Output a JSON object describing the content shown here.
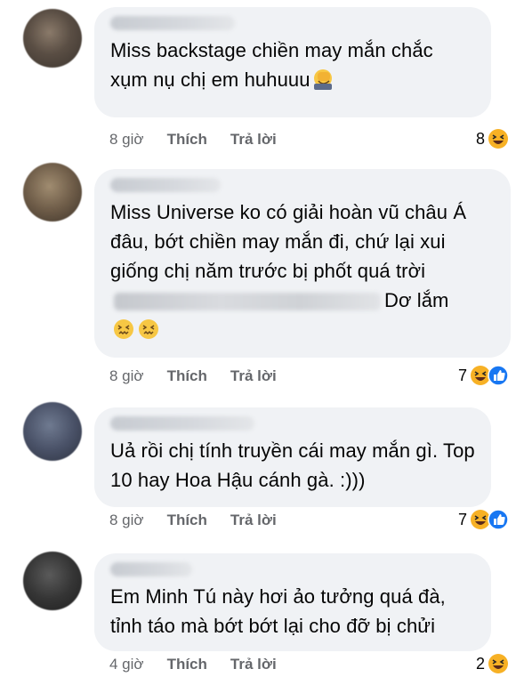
{
  "comments": [
    {
      "text": "Miss backstage chiền may mắn chắc xụm nụ chị em huhuuu",
      "time": "8 giờ",
      "like_label": "Thích",
      "reply_label": "Trả lời",
      "reaction_count": "8",
      "emoji": "face-palm-icon",
      "reaction_icons": [
        "haha-icon"
      ]
    },
    {
      "text_before": "Miss Universe ko có giải hoàn vũ châu Á đâu, bớt chiền may mắn đi, chứ lại xui giống chị năm trước bị phốt quá trời",
      "text_after": "Dơ lắm",
      "time": "8 giờ",
      "like_label": "Thích",
      "reply_label": "Trả lời",
      "reaction_count": "7",
      "emoji": "confounded-face-icon",
      "reaction_icons": [
        "haha-icon",
        "like-icon"
      ]
    },
    {
      "text": "Uả rồi chị tính truyền cái may mắn gì. Top 10 hay Hoa Hậu cánh gà. :)))",
      "time": "8 giờ",
      "like_label": "Thích",
      "reply_label": "Trả lời",
      "reaction_count": "7",
      "reaction_icons": [
        "haha-icon",
        "like-icon"
      ]
    },
    {
      "text": "Em Minh Tú này hơi ảo tưởng quá đà, tỉnh táo mà bớt bớt lại cho đỡ bị chửi",
      "time": "4 giờ",
      "like_label": "Thích",
      "reply_label": "Trả lời",
      "reaction_count": "2",
      "reaction_icons": [
        "haha-icon"
      ]
    }
  ],
  "colors": {
    "bubble": "#f0f2f5",
    "meta_text": "#65676b",
    "like_blue": "#1877f2",
    "haha_yellow": "#f7b125"
  }
}
